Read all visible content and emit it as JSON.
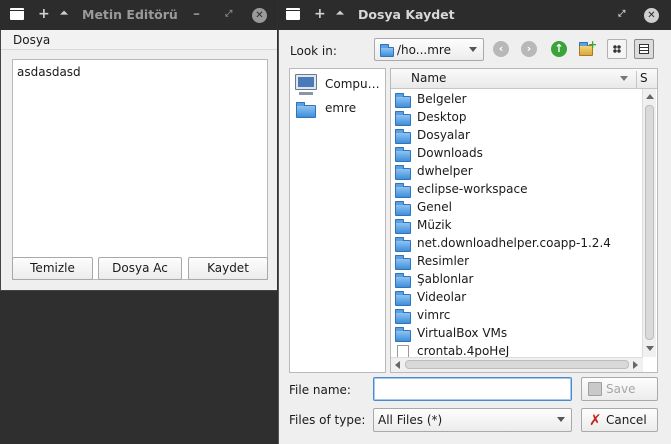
{
  "editor": {
    "title": "Metin Editörü",
    "menu": [
      "Dosya"
    ],
    "text": "asdasdasd",
    "buttons": {
      "clear": "Temizle",
      "open": "Dosya Ac",
      "save": "Kaydet"
    }
  },
  "dialog": {
    "title": "Dosya Kaydet",
    "look_in_label": "Look in:",
    "look_in_value": "/ho...mre",
    "sidebar": [
      {
        "label": "Compu…",
        "icon": "computer-icon"
      },
      {
        "label": "emre",
        "icon": "folder-icon"
      }
    ],
    "columns": {
      "name": "Name",
      "size": "S"
    },
    "files": [
      {
        "name": "Belgeler",
        "type": "folder"
      },
      {
        "name": "Desktop",
        "type": "folder"
      },
      {
        "name": "Dosyalar",
        "type": "folder"
      },
      {
        "name": "Downloads",
        "type": "folder"
      },
      {
        "name": "dwhelper",
        "type": "folder"
      },
      {
        "name": "eclipse-workspace",
        "type": "folder"
      },
      {
        "name": "Genel",
        "type": "folder"
      },
      {
        "name": "Müzik",
        "type": "folder"
      },
      {
        "name": "net.downloadhelper.coapp-1.2.4",
        "type": "folder"
      },
      {
        "name": "Resimler",
        "type": "folder"
      },
      {
        "name": "Şablonlar",
        "type": "folder"
      },
      {
        "name": "Videolar",
        "type": "folder"
      },
      {
        "name": "vimrc",
        "type": "folder"
      },
      {
        "name": "VirtualBox VMs",
        "type": "folder"
      },
      {
        "name": "crontab.4poHeJ",
        "type": "file"
      }
    ],
    "file_name_label": "File name:",
    "file_name_value": "",
    "file_type_label": "Files of type:",
    "file_type_value": "All Files (*)",
    "save_label": "Save",
    "cancel_label": "Cancel"
  },
  "colors": {
    "titlebar": "#2c2c2c",
    "window_bg": "#efefef",
    "folder": "#3f8fdb",
    "cancel": "#c0261c",
    "up_arrow": "#3aa33a"
  }
}
